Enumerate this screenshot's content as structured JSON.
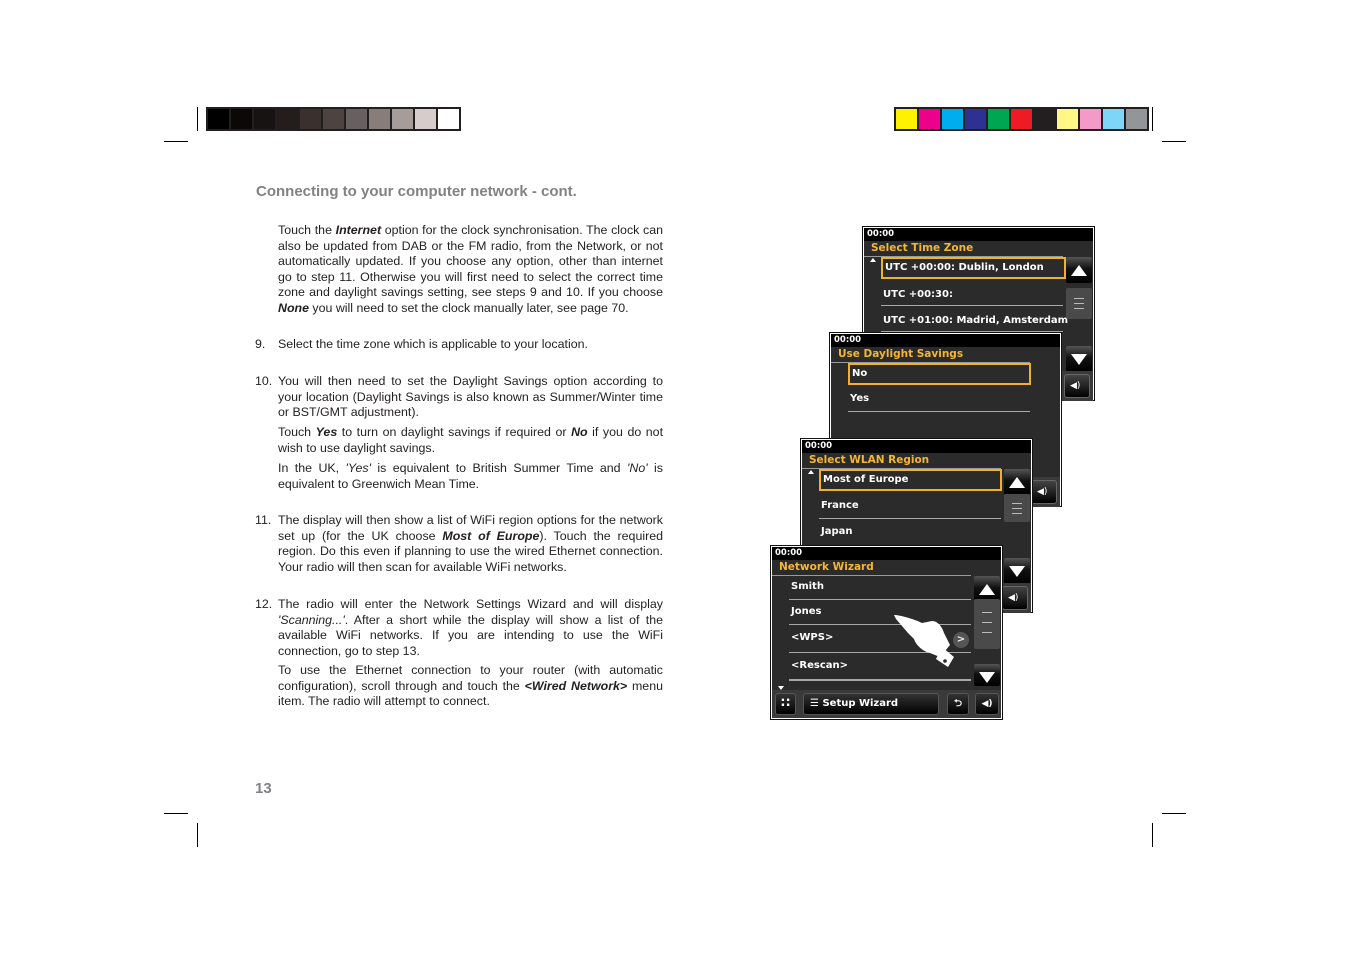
{
  "colorbars": {
    "grayscale": [
      "#000000",
      "#0b0908",
      "#171312",
      "#231e1c",
      "#3a302e",
      "#4d4442",
      "#686060",
      "#877d7a",
      "#a69c9a",
      "#d6cccc",
      "#ffffff"
    ],
    "process": [
      "#fff200",
      "#ec008c",
      "#00aeef",
      "#2e3192",
      "#00a651",
      "#ed1c24",
      "#231f20",
      "#fff685",
      "#f49ac9",
      "#7dd6f7",
      "#939598"
    ]
  },
  "header": {
    "title": "Connecting to your computer network - cont."
  },
  "intro": {
    "p1_pre": "Touch the ",
    "p1_em": "Internet",
    "p1_post": " option for the clock synchronisation. The clock can also be updated from DAB or the FM radio, from the Network, or not automatically updated. If you choose any option, other than internet go to step 11. Otherwise you will first need to select the correct time zone and daylight savings setting, see steps 9 and 10. If you choose ",
    "p1_em2": "None",
    "p1_end": " you will need to set the clock manually later, see page 70."
  },
  "steps": [
    {
      "num": "9.",
      "text": "Select the time zone which is applicable to your location."
    },
    {
      "num": "10.",
      "text": "You will then need to set the Daylight Savings option according to your location (Daylight Savings is also known as Summer/Winter time or BST/GMT adjustment).",
      "p2_a": "Touch ",
      "p2_yes": "Yes",
      "p2_b": " to turn on daylight savings if required or ",
      "p2_no": "No",
      "p2_c": " if you do not wish to use daylight savings.",
      "p3_a": "In the UK, ",
      "p3_yes": "'Yes'",
      "p3_b": " is equivalent to British Summer Time and ",
      "p3_no": "'No'",
      "p3_c": " is equivalent to Greenwich Mean Time."
    },
    {
      "num": "11.",
      "text_a": "The display will then show a list of WiFi region options for the network set up (for the UK choose ",
      "text_em": "Most of Europe",
      "text_b": "). Touch the required region. Do this even if planning to use the wired Ethernet connection. Your radio will then scan for available WiFi networks."
    },
    {
      "num": "12.",
      "text_a": "The radio will enter the Network Settings Wizard and will display ",
      "text_em": "'Scanning...'",
      "text_b": ". After a short while the display will show a list of the available WiFi networks. If you are intending to use the WiFi connection, go to step 13.",
      "p2_a": "To use the Ethernet connection to your router (with automatic configuration), scroll through and touch the ",
      "p2_em": "<Wired Network>",
      "p2_b": " menu item. The radio will attempt to connect."
    }
  ],
  "page_number": "13",
  "screens": {
    "timezone": {
      "clock": "00:00",
      "title": "Select Time Zone",
      "items": [
        "UTC +00:00: Dublin, London",
        "UTC +00:30:",
        "UTC +01:00: Madrid, Amsterdam"
      ],
      "selected": 0
    },
    "daylight": {
      "clock": "00:00",
      "title": "Use Daylight Savings",
      "items": [
        "No",
        "Yes"
      ],
      "selected": 0
    },
    "wlan": {
      "clock": "00:00",
      "title": "Select WLAN Region",
      "items": [
        "Most of Europe",
        "France",
        "Japan"
      ],
      "selected": 0
    },
    "wizard": {
      "clock": "00:00",
      "title": "Network Wizard",
      "items": [
        "Smith",
        "Jones",
        "<WPS>",
        "<Rescan>"
      ],
      "chevron": ">",
      "bottom_label": "Setup Wizard"
    }
  },
  "icons": {
    "menu": "☰",
    "back": "⮌",
    "volume": "◀)",
    "grid": "∷"
  }
}
